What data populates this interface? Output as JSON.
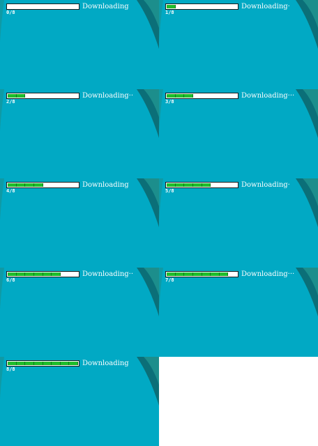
{
  "frames": [
    {
      "count": "0/8",
      "status": "Downloading",
      "done": 0,
      "total": 8
    },
    {
      "count": "1/8",
      "status": "Downloading·",
      "done": 1,
      "total": 8
    },
    {
      "count": "2/8",
      "status": "Downloading··",
      "done": 2,
      "total": 8
    },
    {
      "count": "3/8",
      "status": "Downloading···",
      "done": 3,
      "total": 8
    },
    {
      "count": "4/8",
      "status": "Downloading",
      "done": 4,
      "total": 8
    },
    {
      "count": "5/8",
      "status": "Downloading·",
      "done": 5,
      "total": 8
    },
    {
      "count": "6/8",
      "status": "Downloading··",
      "done": 6,
      "total": 8
    },
    {
      "count": "7/8",
      "status": "Downloading···",
      "done": 7,
      "total": 8
    },
    {
      "count": "8/8",
      "status": "Downloading",
      "done": 8,
      "total": 8
    }
  ],
  "colors": {
    "background": "#01a9c4",
    "corner_dark": "#0b6f78",
    "corner_mid": "#1c8e8c",
    "bar_track": "#ffffff",
    "bar_fill": "#1fbd2c",
    "text": "#ffffff"
  }
}
